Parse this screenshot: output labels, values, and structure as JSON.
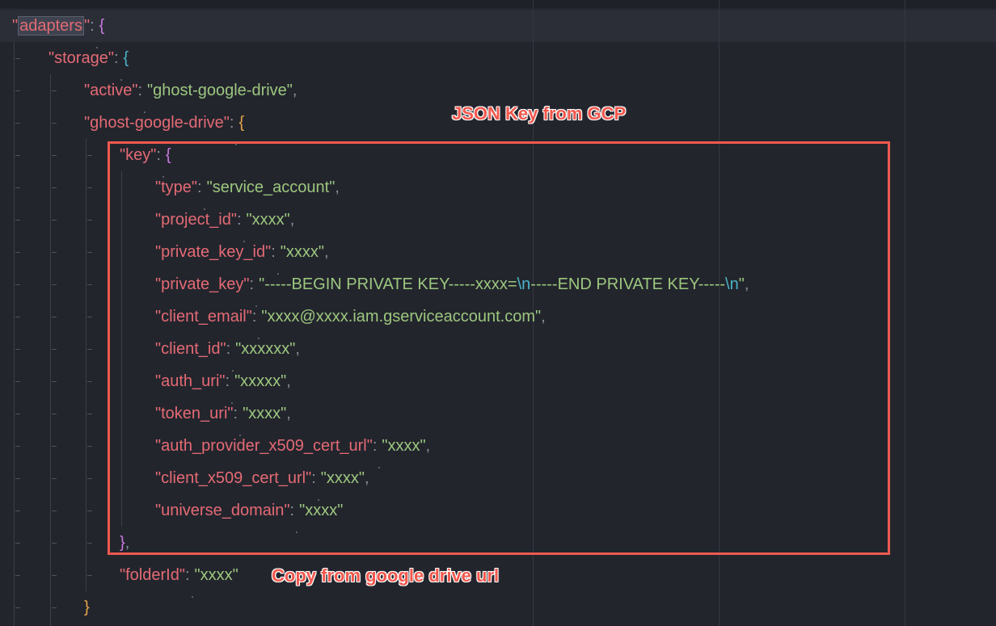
{
  "annotations": {
    "box_label": "JSON Key from GCP",
    "folder_note": "Copy from google drive url"
  },
  "code": {
    "adapters_key": "adapters",
    "storage_key": "storage",
    "active_key": "active",
    "active_value": "ghost-google-drive",
    "ghost_key": "ghost-google-drive",
    "key_key": "key",
    "type_key": "type",
    "type_value": "service_account",
    "project_id_key": "project_id",
    "project_id_value": "xxxx",
    "private_key_id_key": "private_key_id",
    "private_key_id_value": "xxxx",
    "private_key_key": "private_key",
    "private_key_part1": "-----BEGIN PRIVATE KEY-----xxxx=",
    "private_key_part2": "-----END PRIVATE KEY-----",
    "escape_newline": "\\n",
    "client_email_key": "client_email",
    "client_email_value": "xxxx@xxxx.iam.gserviceaccount.com",
    "client_id_key": "client_id",
    "client_id_value": "xxxxxx",
    "auth_uri_key": "auth_uri",
    "auth_uri_value": "xxxxx",
    "token_uri_key": "token_uri",
    "token_uri_value": "xxxx",
    "auth_provider_key": "auth_provider_x509_cert_url",
    "auth_provider_value": "xxxx",
    "client_x509_key": "client_x509_cert_url",
    "client_x509_value": "xxxx",
    "universe_domain_key": "universe_domain",
    "universe_domain_value": "xxxx",
    "folder_id_key": "folderId",
    "folder_id_value": "xxxx"
  },
  "colors": {
    "background": "#23252d",
    "key": "#e46a74",
    "string": "#9cc77e",
    "escape": "#4ab4c8",
    "annotation": "#ef5a4f"
  }
}
